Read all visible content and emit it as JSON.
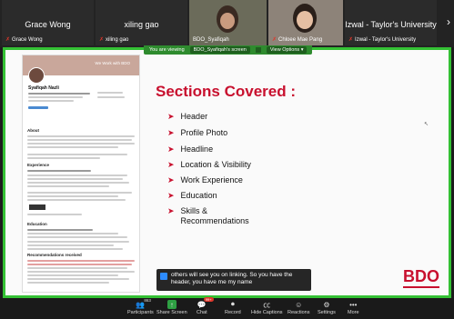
{
  "gallery": {
    "tiles": [
      {
        "big_name": "Grace Wong",
        "small_name": "Grace Wong"
      },
      {
        "big_name": "xiling gao",
        "small_name": "xiling gao"
      },
      {
        "small_name": "BDO_Syafiqah"
      },
      {
        "small_name": "Chloee Mae Pang"
      },
      {
        "big_name": "Izwal - Taylor's University",
        "small_name": "Izwal - Taylor's University"
      }
    ],
    "next_icon": "chevron-right-icon"
  },
  "banner": {
    "prefix": "You are viewing",
    "presenter": "BDO_Syafiqah's screen",
    "view_options": "View Options"
  },
  "slide": {
    "title": "Sections Covered :",
    "items": [
      "Header",
      "Profile Photo",
      "Headline",
      "Location & Visibility",
      "Work Experience",
      "Education",
      "Skills &\nRecommendations"
    ],
    "logo": "BDO",
    "profile": {
      "banner_text": "We Work with BDO",
      "name": "Syafiqah Nazli",
      "about_label": "About",
      "experience_label": "Experience",
      "education_label": "Education",
      "recommendations_label": "Recommendations received"
    }
  },
  "caption": {
    "text": "others will see you on linking. So you have the header, you have me my name"
  },
  "toolbar": {
    "participants_count": "863",
    "participants": "Participants",
    "share": "Share Screen",
    "chat": "Chat",
    "chat_badge": "99+",
    "record": "Record",
    "captions": "Hide Captions",
    "reactions": "Reactions",
    "settings": "Settings",
    "more": "More"
  }
}
